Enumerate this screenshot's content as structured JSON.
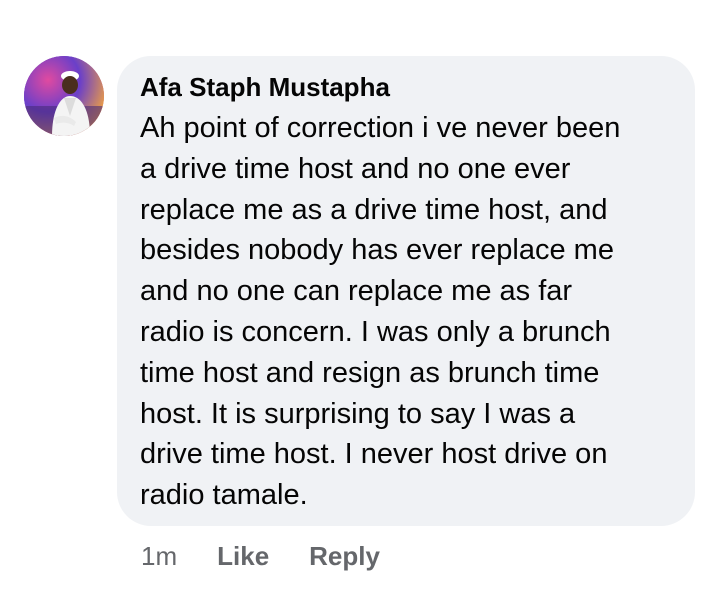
{
  "comment": {
    "author": "Afa Staph Mustapha",
    "text": "Ah point of correction i ve never been\na drive time host and no one ever\nreplace me as a drive time host,  and\nbesides nobody has ever replace me\nand no one can replace me as far\nradio is concern. I was only a brunch\ntime host and resign as brunch time\nhost. It is surprising to say I was a\ndrive time host. I never host drive on\nradio tamale.",
    "avatar_icon": "profile-photo"
  },
  "actions": {
    "time": "1m",
    "like_label": "Like",
    "reply_label": "Reply"
  },
  "colors": {
    "bubble_bg": "#f0f2f5",
    "text": "#050505",
    "secondary_text": "#65676b"
  }
}
